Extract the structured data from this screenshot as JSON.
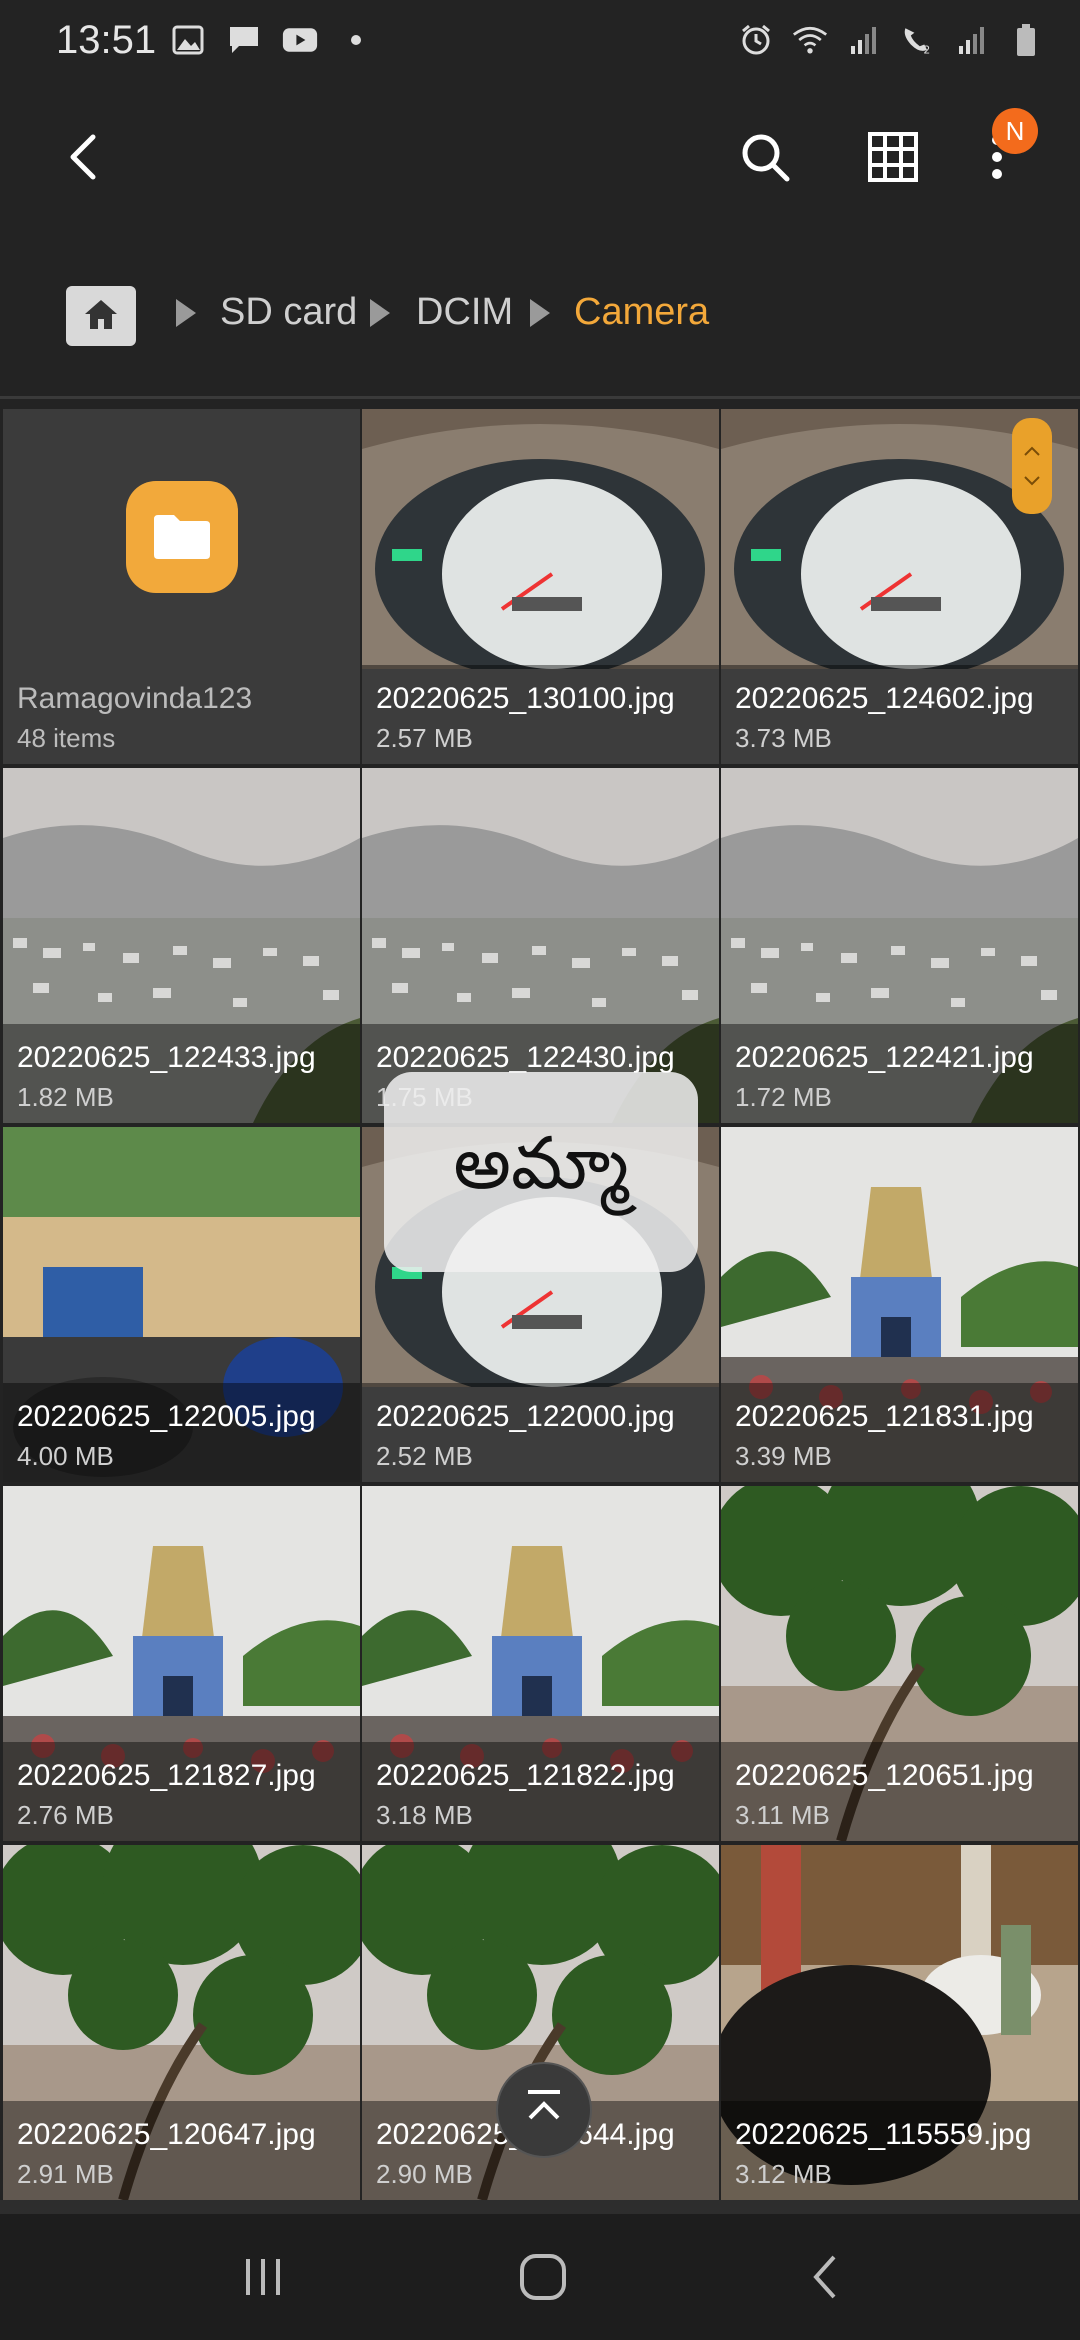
{
  "status_bar": {
    "time": "13:51",
    "left_icons": [
      "gallery-icon",
      "message-icon",
      "youtube-icon",
      "dot-icon"
    ],
    "right_icons": [
      "alarm-icon",
      "wifi-icon",
      "signal-icon",
      "volte-call-icon",
      "signal-icon",
      "battery-icon"
    ]
  },
  "toolbar": {
    "back_icon": "back-arrow-icon",
    "search_icon": "search-icon",
    "grid_icon": "grid-view-icon",
    "more_icon": "more-vertical-icon",
    "badge_label": "N"
  },
  "breadcrumb": {
    "home_icon": "home-icon",
    "items": [
      "SD card",
      "DCIM",
      "Camera"
    ]
  },
  "folder": {
    "name": "Ramagovinda123",
    "count": "48 items"
  },
  "files": [
    {
      "name": "20220625_130100.jpg",
      "size": "2.57 MB",
      "kind": "speedo"
    },
    {
      "name": "20220625_124602.jpg",
      "size": "3.73 MB",
      "kind": "speedo"
    },
    {
      "name": "20220625_122433.jpg",
      "size": "1.82 MB",
      "kind": "city"
    },
    {
      "name": "20220625_122430.jpg",
      "size": "1.75 MB",
      "kind": "city"
    },
    {
      "name": "20220625_122421.jpg",
      "size": "1.72 MB",
      "kind": "city"
    },
    {
      "name": "20220625_122005.jpg",
      "size": "4.00 MB",
      "kind": "gate"
    },
    {
      "name": "20220625_122000.jpg",
      "size": "2.52 MB",
      "kind": "speedo"
    },
    {
      "name": "20220625_121831.jpg",
      "size": "3.39 MB",
      "kind": "temple"
    },
    {
      "name": "20220625_121827.jpg",
      "size": "2.76 MB",
      "kind": "temple"
    },
    {
      "name": "20220625_121822.jpg",
      "size": "3.18 MB",
      "kind": "temple"
    },
    {
      "name": "20220625_120651.jpg",
      "size": "3.11 MB",
      "kind": "tree"
    },
    {
      "name": "20220625_120647.jpg",
      "size": "2.91 MB",
      "kind": "tree"
    },
    {
      "name": "20220625_120644.jpg",
      "size": "2.90 MB",
      "kind": "tree"
    },
    {
      "name": "20220625_115559.jpg",
      "size": "3.12 MB",
      "kind": "cow"
    }
  ],
  "toast": {
    "text": "అమ్మా"
  },
  "scroll_top_icon": "scroll-to-top-icon",
  "navbar": {
    "icons": [
      "recent-apps-icon",
      "home-nav-icon",
      "back-nav-icon"
    ]
  },
  "colors": {
    "accent": "#f3a83a",
    "background": "#232323",
    "badge": "#f36b1c"
  }
}
